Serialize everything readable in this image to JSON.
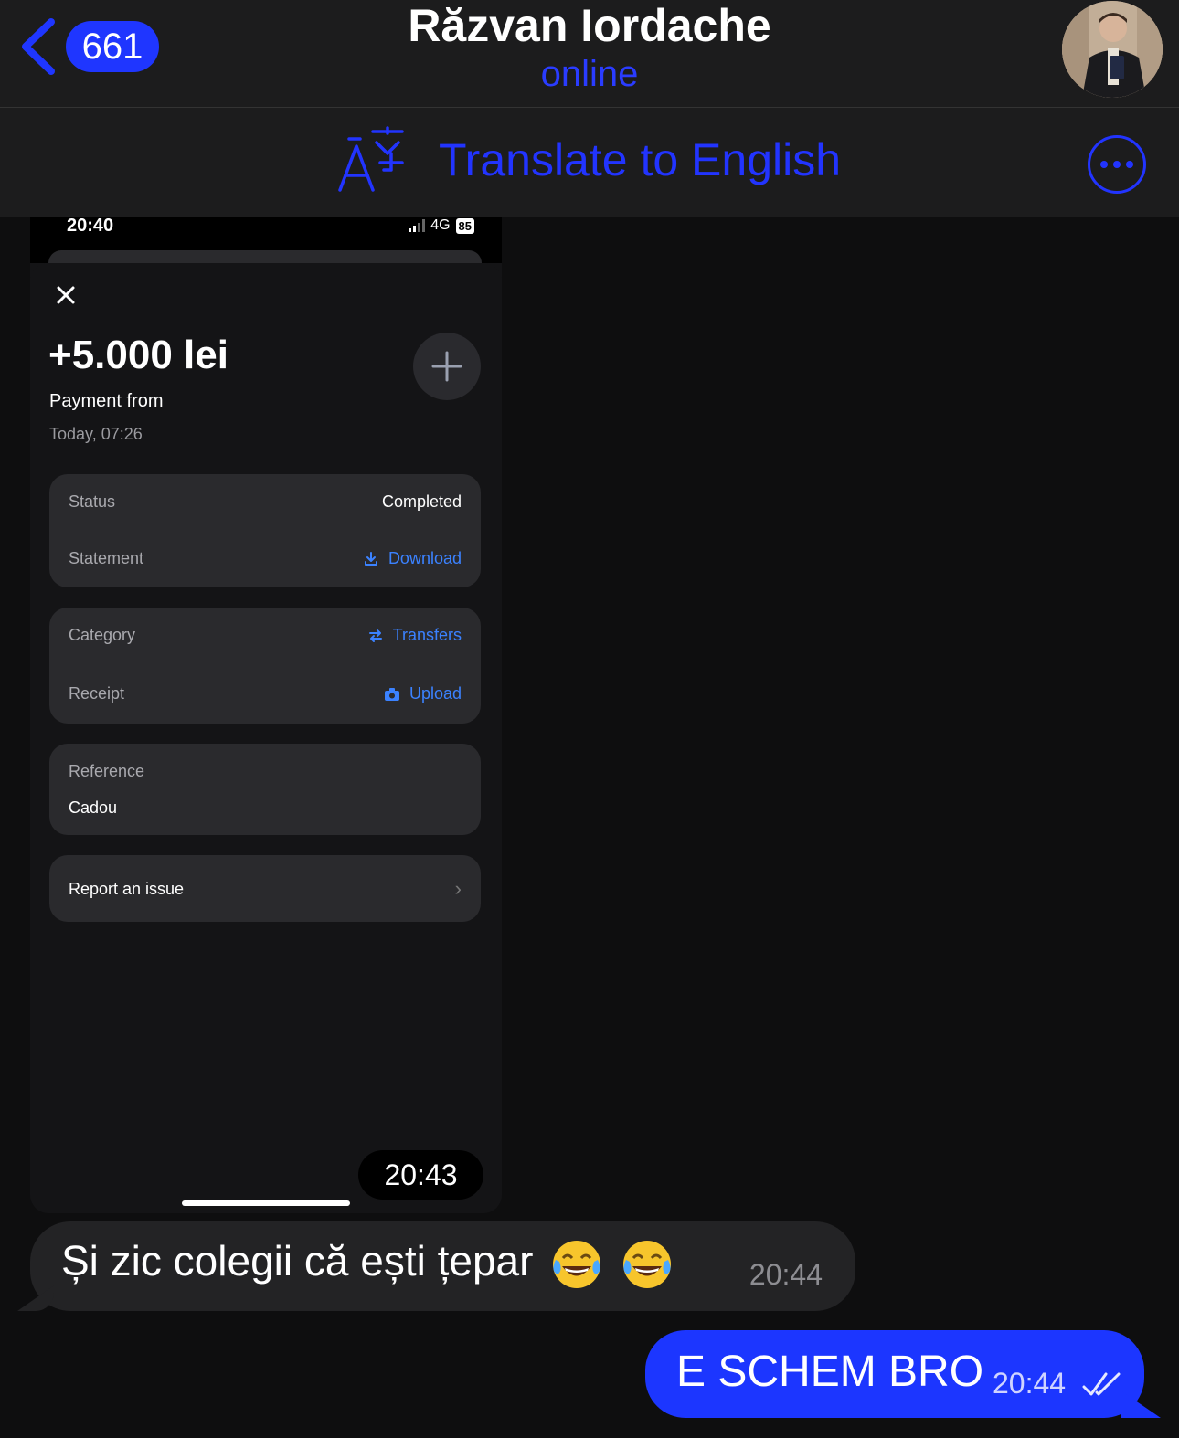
{
  "header": {
    "back_count": "661",
    "title": "Răzvan Iordache",
    "status": "online"
  },
  "translate_bar": {
    "label": "Translate to English"
  },
  "screenshot": {
    "status_time": "20:40",
    "network": "4G",
    "battery": "85",
    "amount": "+5.000 lei",
    "payment_from": "Payment from",
    "date": "Today, 07:26",
    "status_label": "Status",
    "status_value": "Completed",
    "statement_label": "Statement",
    "statement_action": "Download",
    "category_label": "Category",
    "category_value": "Transfers",
    "receipt_label": "Receipt",
    "receipt_action": "Upload",
    "reference_label": "Reference",
    "reference_value": "Cadou",
    "report_label": "Report an issue"
  },
  "messages": {
    "screenshot_time": "20:43",
    "incoming_text": "Și zic colegii că ești țepar",
    "incoming_time": "20:44",
    "outgoing_text": "E SCHEM BRO",
    "outgoing_time": "20:44"
  },
  "colors": {
    "accent": "#1c36ff",
    "link_in_screenshot": "#3b82ff",
    "background": "#0e0e0f"
  }
}
